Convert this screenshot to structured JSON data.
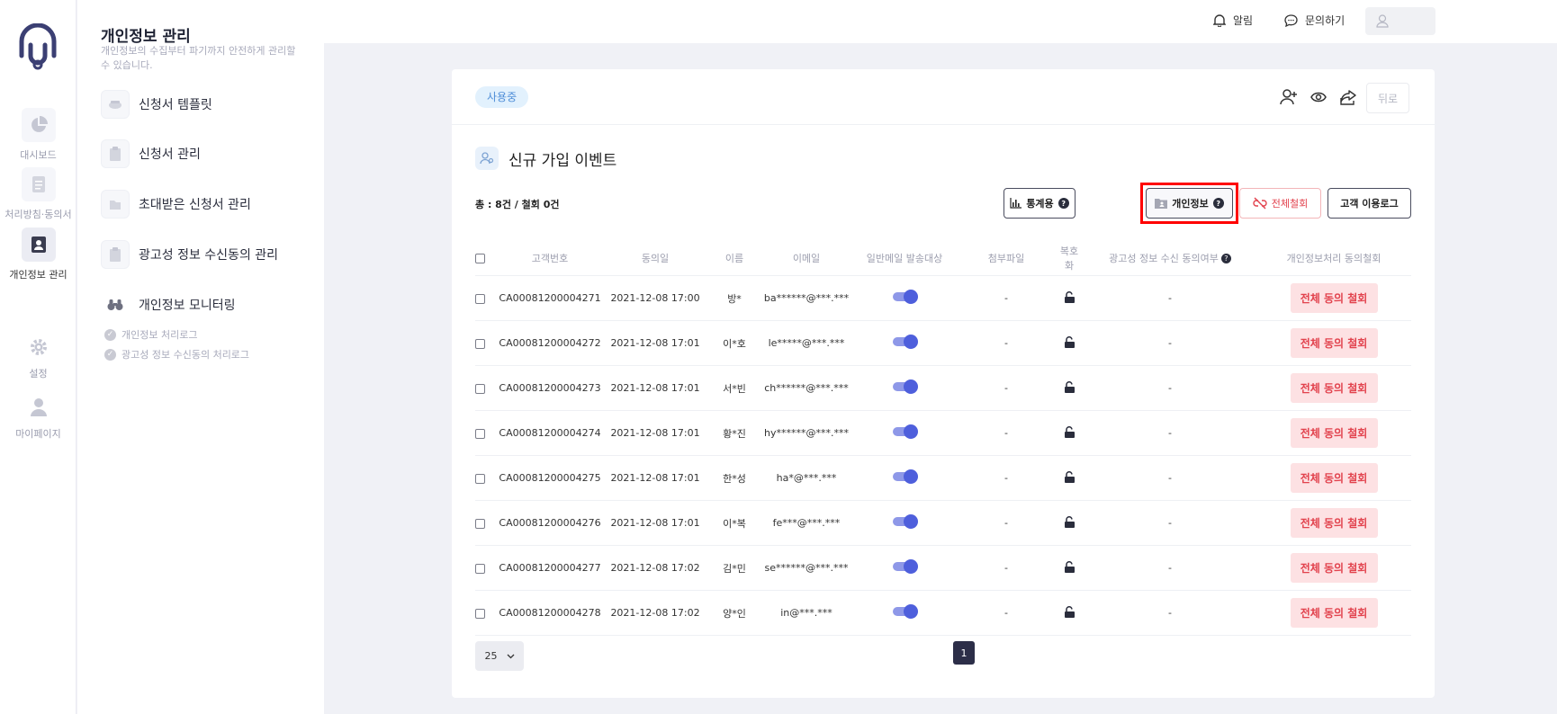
{
  "rail": {
    "items": [
      {
        "label": "대시보드",
        "icon": "pie-chart-icon"
      },
      {
        "label": "처리방침·동의서",
        "icon": "document-icon"
      },
      {
        "label": "개인정보 관리",
        "icon": "id-card-icon",
        "active": true
      },
      {
        "label": "설정",
        "icon": "gear-icon"
      },
      {
        "label": "마이페이지",
        "icon": "user-icon"
      }
    ]
  },
  "subnav": {
    "title": "개인정보 관리",
    "description": "개인정보의 수집부터 파기까지 안전하게 관리할 수 있습니다.",
    "items": [
      {
        "label": "신청서 템플릿",
        "icon": "template-icon"
      },
      {
        "label": "신청서 관리",
        "icon": "clipboard-icon"
      },
      {
        "label": "초대받은 신청서 관리",
        "icon": "folder-icon"
      },
      {
        "label": "광고성 정보 수신동의 관리",
        "icon": "clipboard-icon"
      },
      {
        "label": "개인정보 모니터링",
        "icon": "binoculars-icon"
      }
    ],
    "subitems": [
      {
        "label": "개인정보 처리로그"
      },
      {
        "label": "광고성 정보 수신동의 처리로그"
      }
    ]
  },
  "topbar": {
    "alarm": "알림",
    "inquiry": "문의하기"
  },
  "card": {
    "status_badge": "사용중",
    "back": "뒤로",
    "title": "신규 가입 이벤트",
    "count": "총 : 8건 / 철회 0건",
    "buttons": {
      "stats": "통계용",
      "personal": "개인정보",
      "revoke_all": "전체철회",
      "usage_log": "고객 이용로그"
    },
    "columns": [
      "고객번호",
      "동의일",
      "이름",
      "이메일",
      "일반메일 발송대상",
      "첨부파일",
      "복호화",
      "광고성 정보 수신 동의여부",
      "개인정보처리 동의철회"
    ],
    "revoke_label": "전체 동의 철회",
    "rows": [
      {
        "id": "CA00081200004271",
        "date": "2021-12-08 17:00",
        "name": "방*",
        "email": "ba******@***.***",
        "mail_target": true,
        "attach": "-",
        "ad": "-"
      },
      {
        "id": "CA00081200004272",
        "date": "2021-12-08 17:01",
        "name": "이*호",
        "email": "le*****@***.***",
        "mail_target": true,
        "attach": "-",
        "ad": "-"
      },
      {
        "id": "CA00081200004273",
        "date": "2021-12-08 17:01",
        "name": "서*빈",
        "email": "ch******@***.***",
        "mail_target": true,
        "attach": "-",
        "ad": "-"
      },
      {
        "id": "CA00081200004274",
        "date": "2021-12-08 17:01",
        "name": "황*진",
        "email": "hy******@***.***",
        "mail_target": true,
        "attach": "-",
        "ad": "-"
      },
      {
        "id": "CA00081200004275",
        "date": "2021-12-08 17:01",
        "name": "한*성",
        "email": "ha*@***.***",
        "mail_target": true,
        "attach": "-",
        "ad": "-"
      },
      {
        "id": "CA00081200004276",
        "date": "2021-12-08 17:01",
        "name": "이*복",
        "email": "fe***@***.***",
        "mail_target": true,
        "attach": "-",
        "ad": "-"
      },
      {
        "id": "CA00081200004277",
        "date": "2021-12-08 17:02",
        "name": "김*민",
        "email": "se******@***.***",
        "mail_target": true,
        "attach": "-",
        "ad": "-"
      },
      {
        "id": "CA00081200004278",
        "date": "2021-12-08 17:02",
        "name": "양*인",
        "email": "in@***.***",
        "mail_target": true,
        "attach": "-",
        "ad": "-"
      }
    ],
    "per_page": "25",
    "page": "1"
  },
  "colors": {
    "accent": "#4e5fdc",
    "danger": "#e2424d",
    "danger_bg": "#fde1e3",
    "badge_bg": "#e2f1fd",
    "highlight": "#ff0000"
  }
}
